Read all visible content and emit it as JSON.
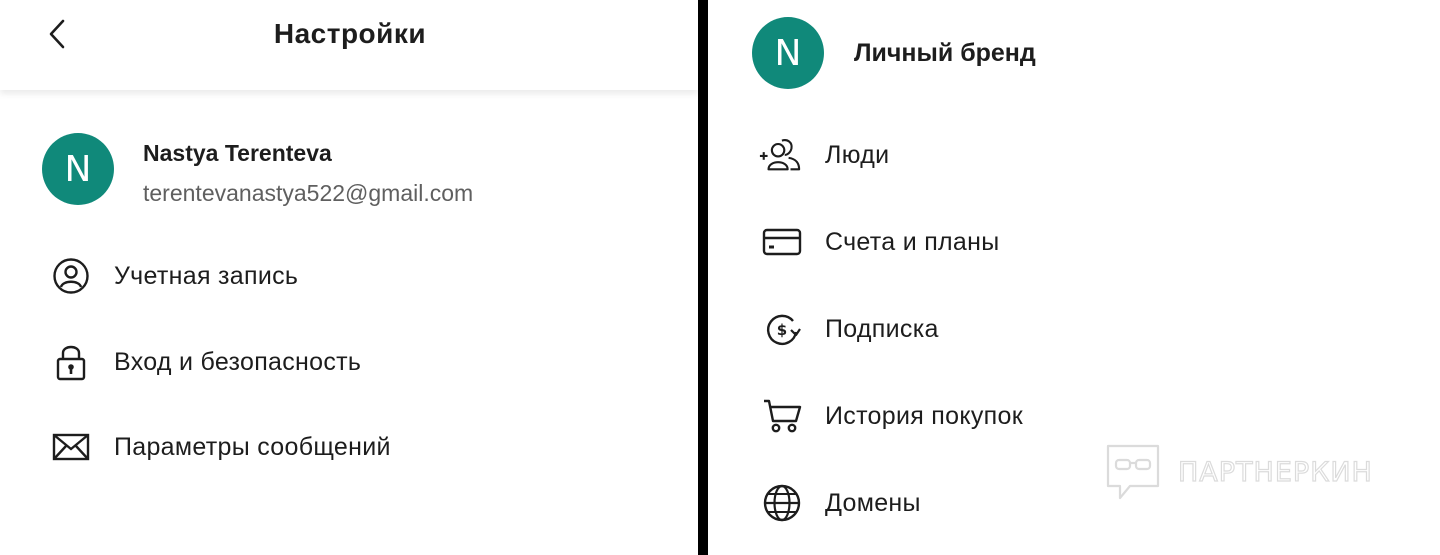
{
  "colors": {
    "accent": "#10897a",
    "text": "#1d1d1d",
    "secondary_text": "#5f5f5f",
    "divider": "#000000"
  },
  "settings": {
    "back_icon": "chevron-left-icon",
    "title": "Настройки",
    "user": {
      "avatar_letter": "N",
      "name": "Nastya Terenteva",
      "email": "terentevanastya522@gmail.com"
    },
    "items": [
      {
        "label": "Учетная запись",
        "icon": "user-circle-icon"
      },
      {
        "label": "Вход и безопасность",
        "icon": "lock-icon"
      },
      {
        "label": "Параметры сообщений",
        "icon": "envelope-icon"
      }
    ]
  },
  "brand": {
    "avatar_letter": "N",
    "title": "Личный бренд",
    "items": [
      {
        "label": "Люди",
        "icon": "add-people-icon"
      },
      {
        "label": "Счета и планы",
        "icon": "credit-card-icon"
      },
      {
        "label": "Подписка",
        "icon": "dollar-refresh-icon"
      },
      {
        "label": "История покупок",
        "icon": "shopping-cart-icon"
      },
      {
        "label": "Домены",
        "icon": "globe-icon"
      }
    ]
  },
  "watermark": {
    "text": "ПАРТНЕРКИН",
    "icon": "chat-glasses-icon"
  }
}
